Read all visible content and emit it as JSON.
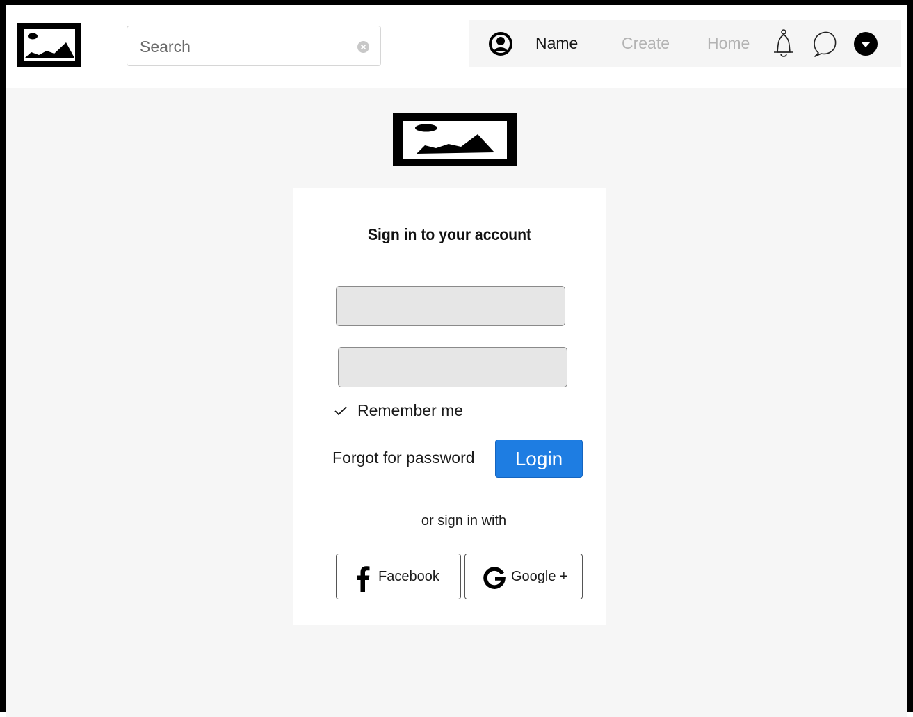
{
  "header": {
    "search": {
      "placeholder": "Search",
      "value": ""
    },
    "nav": {
      "name_label": "Name",
      "create_label": "Create",
      "home_label": "Home"
    }
  },
  "icons": {
    "logo": "image-placeholder-icon",
    "clear": "clear-circle-icon",
    "avatar": "user-circle-icon",
    "notifications": "bell-icon",
    "messages": "chat-bubble-icon",
    "menu": "dropdown-circle-icon",
    "check": "checkmark-icon",
    "facebook": "facebook-icon",
    "google": "google-icon"
  },
  "login": {
    "title": "Sign in to your account",
    "username": {
      "value": "",
      "placeholder": ""
    },
    "password": {
      "value": "",
      "placeholder": ""
    },
    "remember_label": "Remember me",
    "forgot_label": "Forgot for password",
    "login_label": "Login",
    "or_label": "or sign in with",
    "social": {
      "facebook_label": "Facebook",
      "google_label": "Google +"
    }
  },
  "colors": {
    "primary": "#1e7de2",
    "nav_panel": "#f5f5f5",
    "content_bg": "#f6f6f6",
    "muted_text": "#b3b3b3"
  }
}
